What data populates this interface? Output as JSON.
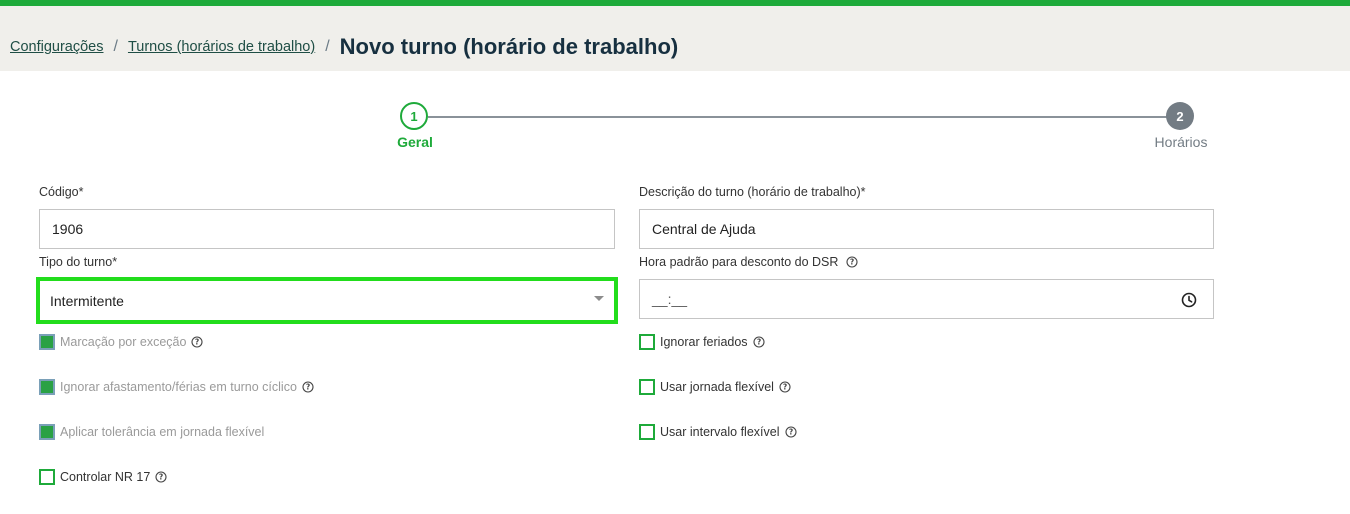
{
  "breadcrumb": {
    "item1": "Configurações",
    "item2": "Turnos (horários de trabalho)",
    "separator": "/",
    "current": "Novo turno (horário de trabalho)"
  },
  "stepper": {
    "steps": [
      {
        "number": "1",
        "label": "Geral",
        "state": "active"
      },
      {
        "number": "2",
        "label": "Horários",
        "state": "inactive"
      }
    ]
  },
  "form": {
    "codigo": {
      "label": "Código*",
      "value": "1906"
    },
    "descricao": {
      "label": "Descrição do turno (horário de trabalho)*",
      "value": "Central de Ajuda"
    },
    "tipo": {
      "label": "Tipo do turno*",
      "selected": "Intermitente"
    },
    "hora_dsr": {
      "label": "Hora padrão para desconto do DSR",
      "value": "__:__"
    }
  },
  "checkboxes_left": [
    {
      "label": "Marcação por exceção",
      "checked": true,
      "disabled": true,
      "help": true
    },
    {
      "label": "Ignorar afastamento/férias em turno cíclico",
      "checked": true,
      "disabled": true,
      "help": true
    },
    {
      "label": "Aplicar tolerância em jornada flexível",
      "checked": true,
      "disabled": true,
      "help": false
    },
    {
      "label": "Controlar NR 17",
      "checked": false,
      "disabled": false,
      "help": true
    }
  ],
  "checkboxes_right": [
    {
      "label": "Ignorar feriados",
      "checked": false,
      "disabled": false,
      "help": true
    },
    {
      "label": "Usar jornada flexível",
      "checked": false,
      "disabled": false,
      "help": true
    },
    {
      "label": "Usar intervalo flexível",
      "checked": false,
      "disabled": false,
      "help": true
    }
  ],
  "colors": {
    "brand_green": "#1eaa3a",
    "focus_outline": "#22dd1c",
    "header_bg": "#f0efeb",
    "inactive_step": "#737c84"
  },
  "icons": {
    "help": "help-circle-icon",
    "clock": "clock-icon",
    "caret": "caret-down-icon"
  }
}
